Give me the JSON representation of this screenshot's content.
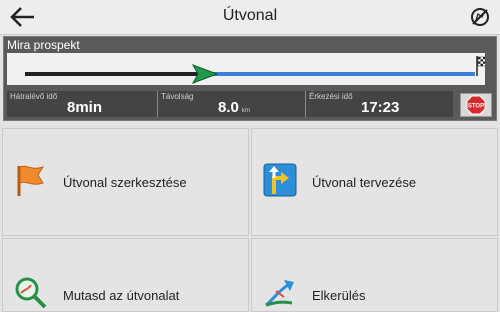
{
  "header": {
    "title": "Útvonal",
    "back_icon": "arrow-left-icon",
    "cancel_icon": "cancel-route-icon"
  },
  "route": {
    "destination": "Mira prospekt",
    "progress": 0.4,
    "colors": {
      "traveled": "#222222",
      "remaining": "#3c7fd6",
      "arrow": "#1e9a4a"
    },
    "stats": [
      {
        "label": "Hátralévő idő",
        "value": "8min",
        "unit": ""
      },
      {
        "label": "Távolság",
        "value": "8.0",
        "unit": "km"
      },
      {
        "label": "Érkezési idő",
        "value": "17:23",
        "unit": ""
      }
    ],
    "stop_label": "STOP"
  },
  "menu": [
    {
      "label": "Útvonal szerkesztése",
      "icon": "flag-icon"
    },
    {
      "label": "Útvonal tervezése",
      "icon": "turn-sign-icon"
    },
    {
      "label": "Mutasd az útvonalat",
      "icon": "magnifier-route-icon"
    },
    {
      "label": "Elkerülés",
      "icon": "detour-arrow-icon"
    }
  ]
}
